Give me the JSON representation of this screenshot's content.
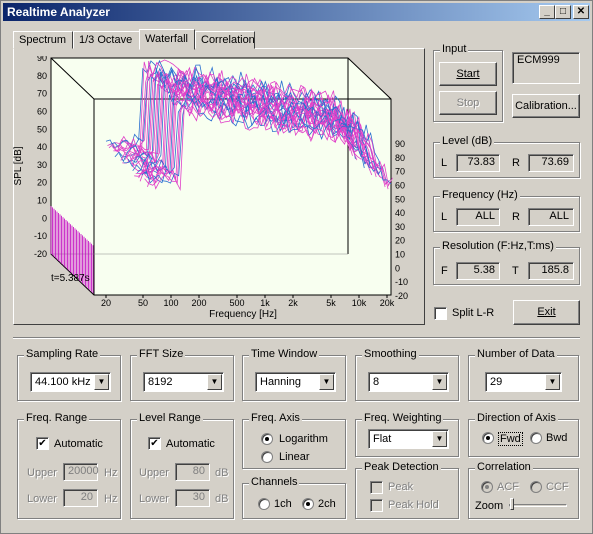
{
  "window": {
    "title": "Realtime Analyzer",
    "min_glyph": "_",
    "max_glyph": "□",
    "close_glyph": "✕"
  },
  "tabs": [
    "Spectrum",
    "1/3 Octave",
    "Waterfall",
    "Correlation"
  ],
  "active_tab": "Waterfall",
  "plot": {
    "ylabel": "SPL [dB]",
    "xlabel": "Frequency [Hz]",
    "time_label": "t=5.387s",
    "left_ticks": [
      "90",
      "80",
      "70",
      "60",
      "50",
      "40",
      "30",
      "20",
      "10",
      "0",
      "-10",
      "-20"
    ],
    "right_ticks": [
      "90",
      "80",
      "70",
      "60",
      "50",
      "40",
      "30",
      "20",
      "10",
      "0",
      "-10",
      "-20"
    ],
    "freq_ticks": [
      "20",
      "50",
      "100",
      "200",
      "500",
      "1k",
      "2k",
      "5k",
      "10k",
      "20k"
    ],
    "colors": {
      "trace_a": "#e040c8",
      "trace_b": "#2a6fd0",
      "floor": "#c000c0",
      "bg": "#f8fff0"
    }
  },
  "input": {
    "label": "Input",
    "start": "Start",
    "stop": "Stop",
    "device": "ECM999",
    "calibration": "Calibration..."
  },
  "level": {
    "label": "Level (dB)",
    "l_label": "L",
    "l_value": "73.83",
    "r_label": "R",
    "r_value": "73.69"
  },
  "frequency": {
    "label": "Frequency (Hz)",
    "l_label": "L",
    "l_value": "ALL",
    "r_label": "R",
    "r_value": "ALL"
  },
  "resolution": {
    "label": "Resolution (F:Hz,T:ms)",
    "f_label": "F",
    "f_value": "5.38",
    "t_label": "T",
    "t_value": "185.8"
  },
  "split": {
    "label": "Split L-R",
    "checked": false
  },
  "exit": "Exit",
  "sampling_rate": {
    "label": "Sampling Rate",
    "value": "44.100 kHz"
  },
  "fft_size": {
    "label": "FFT Size",
    "value": "8192"
  },
  "time_window": {
    "label": "Time Window",
    "value": "Hanning"
  },
  "smoothing": {
    "label": "Smoothing",
    "value": "8"
  },
  "number_of_data": {
    "label": "Number of Data",
    "value": "29"
  },
  "freq_range": {
    "label": "Freq. Range",
    "auto": "Automatic",
    "upper": "Upper",
    "upper_value": "20000",
    "lower": "Lower",
    "lower_value": "20",
    "unit": "Hz"
  },
  "level_range": {
    "label": "Level Range",
    "auto": "Automatic",
    "upper": "Upper",
    "upper_value": "80",
    "lower": "Lower",
    "lower_value": "30",
    "unit": "dB"
  },
  "freq_axis": {
    "label": "Freq. Axis",
    "log": "Logarithm",
    "linear": "Linear",
    "selected": "Logarithm"
  },
  "channels": {
    "label": "Channels",
    "ch1": "1ch",
    "ch2": "2ch",
    "selected": "2ch"
  },
  "freq_weighting": {
    "label": "Freq. Weighting",
    "value": "Flat"
  },
  "peak_detection": {
    "label": "Peak Detection",
    "peak": "Peak",
    "peak_hold": "Peak Hold"
  },
  "direction": {
    "label": "Direction of Axis",
    "fwd": "Fwd",
    "bwd": "Bwd",
    "selected": "Fwd"
  },
  "correlation": {
    "label": "Correlation",
    "acf": "ACF",
    "ccf": "CCF",
    "zoom": "Zoom"
  }
}
